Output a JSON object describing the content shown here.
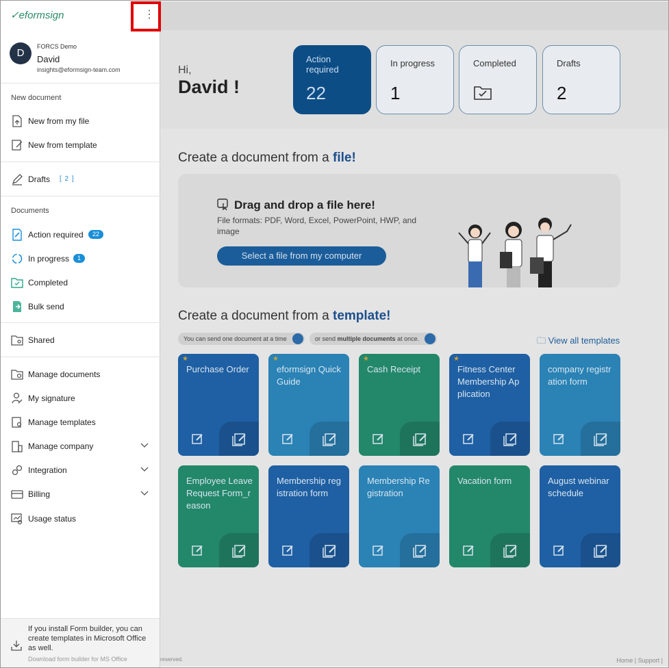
{
  "sidebar": {
    "logo": "eformsign",
    "more_icon": "⋮",
    "avatar_initial": "D",
    "org": "FORCS Demo",
    "user_name": "David",
    "email": "insights@eformsign-team.com",
    "section_new_document": "New document",
    "new_from_file": "New from my file",
    "new_from_template": "New from template",
    "drafts": "Drafts",
    "drafts_count": "[ 2 ]",
    "section_documents": "Documents",
    "action_required": "Action required",
    "action_required_badge": "22",
    "in_progress": "In progress",
    "in_progress_badge": "1",
    "completed": "Completed",
    "bulk_send": "Bulk send",
    "shared": "Shared",
    "manage_documents": "Manage documents",
    "my_signature": "My signature",
    "manage_templates": "Manage templates",
    "manage_company": "Manage company",
    "integration": "Integration",
    "billing": "Billing",
    "usage_status": "Usage status",
    "install_text": "If you install Form builder, you can create templates in Microsoft Office as well.",
    "install_link": "Download form builder for MS Office"
  },
  "main": {
    "greeting": "Hi,",
    "name": "David !",
    "stats": {
      "action_required_label": "Action required",
      "action_required_value": "22",
      "in_progress_label": "In progress",
      "in_progress_value": "1",
      "completed_label": "Completed",
      "drafts_label": "Drafts",
      "drafts_value": "2"
    },
    "file_section": {
      "title_prefix": "Create a document from a",
      "title_emphasis": "file!",
      "drop_title": "Drag and drop a file here!",
      "formats": "File formats: PDF, Word, Excel, PowerPoint, HWP, and image",
      "button": "Select a file from my computer"
    },
    "template_section": {
      "title_prefix": "Create a document from a",
      "title_emphasis": "template!",
      "pill_one": "You can send one document at a time",
      "pill_multi_prefix": "or send",
      "pill_multi_bold": "multiple documents",
      "pill_multi_suffix": "at once.",
      "view_all": "View all templates"
    },
    "templates": [
      {
        "title": "Purchase Order",
        "starred": true,
        "color": "#1f5fa3"
      },
      {
        "title": "eformsign Quick Guide",
        "starred": true,
        "color": "#2a82b5"
      },
      {
        "title": "Cash Receipt",
        "starred": true,
        "color": "#23876a"
      },
      {
        "title": "Fitness Center Membership Ap plication",
        "starred": true,
        "color": "#1f5fa3"
      },
      {
        "title": "company registr ation form",
        "starred": false,
        "color": "#2a82b5"
      },
      {
        "title": "Employee Leave Request Form_r eason",
        "starred": false,
        "color": "#23876a"
      },
      {
        "title": "Membership reg istration form",
        "starred": false,
        "color": "#1f5fa3"
      },
      {
        "title": "Membership Re gistration",
        "starred": false,
        "color": "#2a82b5"
      },
      {
        "title": "Vacation form",
        "starred": false,
        "color": "#23876a"
      },
      {
        "title": "August webinar schedule",
        "starred": false,
        "color": "#1f5fa3"
      }
    ],
    "star_glyph": "★",
    "reserved": "reserved.",
    "footer": "Home  |  Support  |"
  }
}
